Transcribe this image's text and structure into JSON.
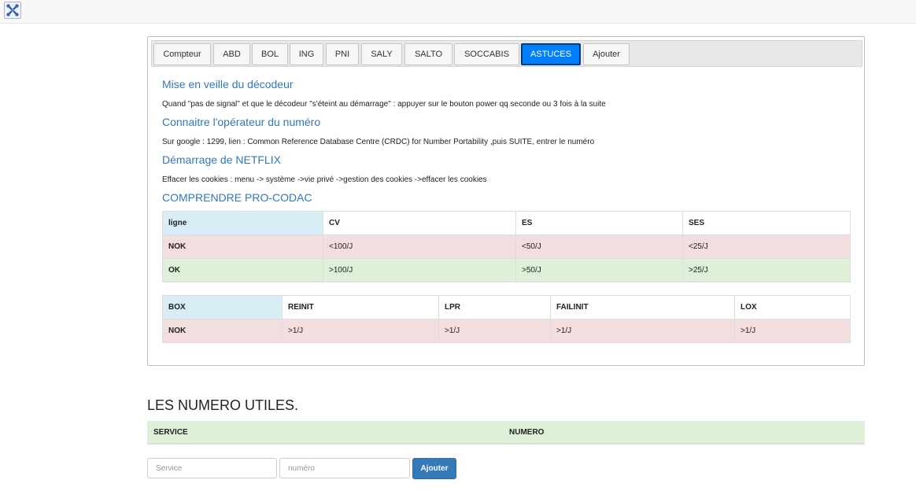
{
  "app": {
    "logo_icon": "network-icon"
  },
  "tabs": [
    {
      "label": "Compteur"
    },
    {
      "label": "ABD"
    },
    {
      "label": "BOL"
    },
    {
      "label": "ING"
    },
    {
      "label": "PNI"
    },
    {
      "label": "SALY"
    },
    {
      "label": "SALTO"
    },
    {
      "label": "SOCCABIS"
    },
    {
      "label": "ASTUCES",
      "active": true
    },
    {
      "label": "Ajouter"
    }
  ],
  "content": {
    "veille": {
      "title": "Mise en veille du décodeur",
      "text": "Quand \"pas de signal\" et que le décodeur \"s'éteint au démarrage\" : appuyer sur le bouton power qq seconde ou 3 fois à la suite"
    },
    "operateur": {
      "title": "Connaitre l'opérateur du numéro",
      "text": "Sur google : 1299, lien : Common Reference Database Centre (CRDC) for Number Portability ,puis SUITE, entrer le numéro"
    },
    "netflix": {
      "title": "Démarrage de NETFLIX",
      "text": "Effacer les cookies : menu -> système ->vie privé ->gestion des cookies ->effacer les cookies"
    },
    "procodac": {
      "title": "COMPRENDRE PRO-CODAC"
    }
  },
  "table1": {
    "headers": [
      "ligne",
      "CV",
      "ES",
      "SES"
    ],
    "rows": [
      [
        "NOK",
        "<100/J",
        "<50/J",
        "<25/J"
      ],
      [
        "OK",
        ">100/J",
        ">50/J",
        ">25/J"
      ]
    ]
  },
  "table2": {
    "headers": [
      "BOX",
      "REINIT",
      "LPR",
      "FAILINIT",
      "LOX"
    ],
    "rows": [
      [
        "NOK",
        ">1/J",
        ">1/J",
        ">1/J",
        ">1/J"
      ]
    ]
  },
  "utiles": {
    "title": "LES NUMERO UTILES.",
    "col_service": "SERVICE",
    "col_numero": "NUMERO",
    "service_placeholder": "Service",
    "numero_placeholder": "numéro",
    "add_button": "Ajouter"
  },
  "colors": {
    "tab_active": "#007fff",
    "title_blue": "#3277b7",
    "row_info": "#d9edf7",
    "row_danger": "#f2dede",
    "row_success": "#dff0d8",
    "button_primary": "#337ab7"
  }
}
